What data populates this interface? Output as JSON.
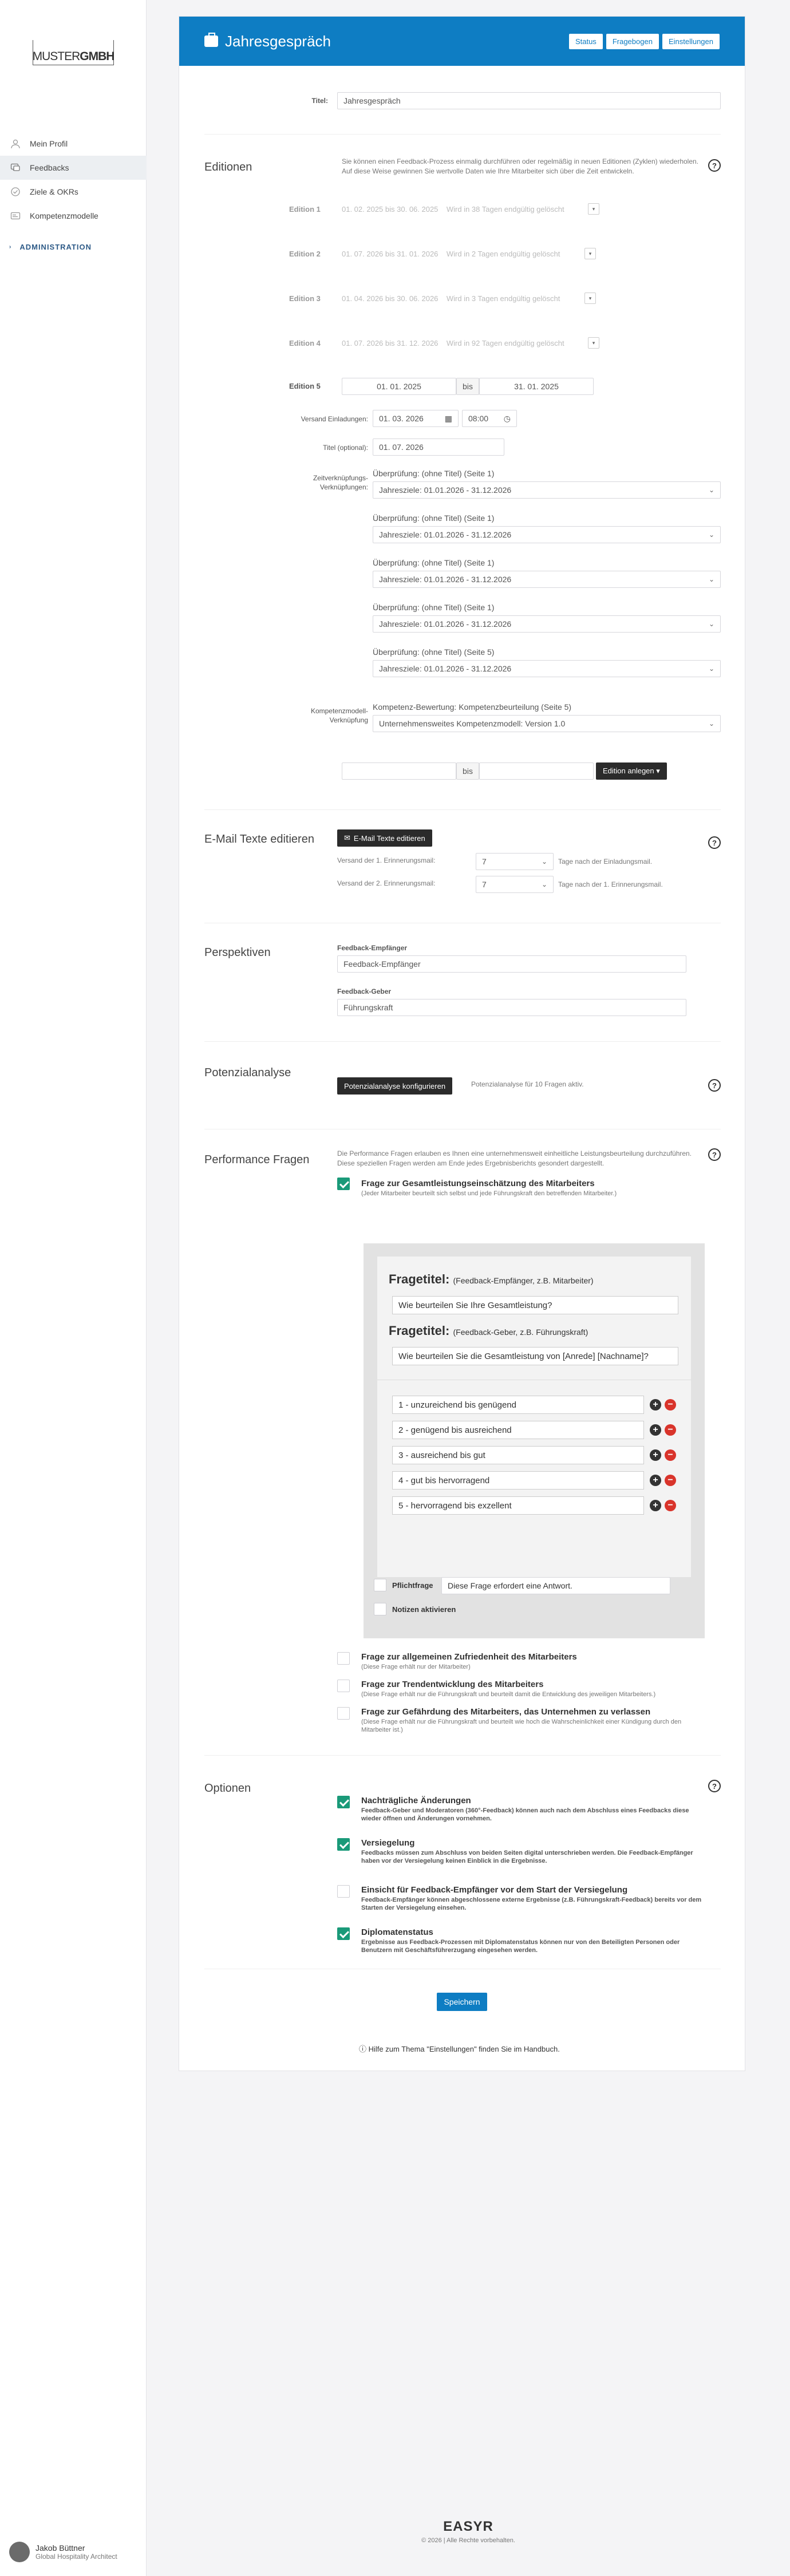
{
  "sidebar": {
    "logo_light": "MUSTER",
    "logo_bold": "GMBH",
    "items": [
      {
        "label": "Mein Profil",
        "icon": "user-icon"
      },
      {
        "label": "Feedbacks",
        "icon": "chat-icon"
      },
      {
        "label": "Ziele & OKRs",
        "icon": "target-icon"
      },
      {
        "label": "Kompetenzmodelle",
        "icon": "id-card-icon"
      }
    ],
    "admin_label": "ADMINISTRATION",
    "user_name": "Jakob Büttner",
    "user_role": "Global Hospitality Architect"
  },
  "header": {
    "title": "Jahresgespräch",
    "buttons": [
      "Status",
      "Fragebogen",
      "Einstellungen"
    ]
  },
  "titel": {
    "label": "Titel:",
    "value": "Jahresgespräch"
  },
  "editionen": {
    "title": "Editionen",
    "description": "Sie können einen Feedback-Prozess einmalig durchführen oder regelmäßig in neuen Editionen (Zyklen) wiederholen. Auf diese Weise gewinnen Sie wertvolle Daten wie Ihre Mitarbeiter sich über die Zeit entwickeln.",
    "list": [
      {
        "label": "Edition 1",
        "text": "01. 02. 2025 bis 30. 06. 2025    Wird in 38 Tagen endgültig gelöscht"
      },
      {
        "label": "Edition 2",
        "text": "01. 07. 2026 bis 31. 01. 2026    Wird in 2 Tagen endgültig gelöscht"
      },
      {
        "label": "Edition 3",
        "text": "01. 04. 2026 bis 30. 06. 2026    Wird in 3 Tagen endgültig gelöscht"
      },
      {
        "label": "Edition 4",
        "text": "01. 07. 2026 bis 31. 12. 2026    Wird in 92 Tagen endgültig gelöscht"
      }
    ],
    "current": {
      "label": "Edition 5",
      "from": "01. 01. 2025",
      "bis": "bis",
      "to": "31. 01. 2025",
      "versand_label": "Versand Einladungen:",
      "versand_date": "01. 03. 2026",
      "versand_time": "08:00",
      "titel_label": "Titel (optional):",
      "titel_value": "01. 07. 2026",
      "zeitverk_label": "Zeitverknüpfungs-Verknüpfungen:",
      "links": [
        {
          "label": "Überprüfung: (ohne Titel) (Seite 1)",
          "value": "Jahresziele: 01.01.2026 - 31.12.2026"
        },
        {
          "label": "Überprüfung: (ohne Titel) (Seite 1)",
          "value": "Jahresziele: 01.01.2026 - 31.12.2026"
        },
        {
          "label": "Überprüfung: (ohne Titel) (Seite 1)",
          "value": "Jahresziele: 01.01.2026 - 31.12.2026"
        },
        {
          "label": "Überprüfung: (ohne Titel) (Seite 1)",
          "value": "Jahresziele: 01.01.2026 - 31.12.2026"
        },
        {
          "label": "Überprüfung: (ohne Titel) (Seite 5)",
          "value": "Jahresziele: 01.01.2026 - 31.12.2026"
        }
      ],
      "kompetenz_label": "Kompetenzmodell-Verknüpfung",
      "kompetenz_title": "Kompetenz-Bewertung: Kompetenzbeurteilung (Seite 5)",
      "kompetenz_value": "Unternehmensweites Kompetenzmodell: Version 1.0"
    },
    "new_bis": "bis",
    "new_button": "Edition anlegen ▾"
  },
  "email": {
    "title": "E-Mail Texte editieren",
    "button": "E-Mail Texte editieren",
    "rows": [
      {
        "label": "Versand der 1. Erinnerungsmail:",
        "value": "7",
        "suffix": "Tage nach der Einladungsmail."
      },
      {
        "label": "Versand der 2. Erinnerungsmail:",
        "value": "7",
        "suffix": "Tage nach der 1. Erinnerungsmail."
      }
    ]
  },
  "perspektiven": {
    "title": "Perspektiven",
    "empf_label": "Feedback-Empfänger",
    "empf_value": "Feedback-Empfänger",
    "geber_label": "Feedback-Geber",
    "geber_value": "Führungskraft"
  },
  "potenzial": {
    "title": "Potenzialanalyse",
    "button": "Potenzialanalyse konfigurieren",
    "info": "Potenzialanalyse für 10 Fragen aktiv."
  },
  "performance": {
    "title": "Performance Fragen",
    "description": "Die Performance Fragen erlauben es Ihnen eine unternehmensweit einheitliche Leistungsbeurteilung durchzuführen. Diese speziellen Fragen werden am Ende jedes Ergebnisberichts gesondert dargestellt.",
    "q1_title": "Frage zur Gesamtleistungseinschätzung des Mitarbeiters",
    "q1_sub": "(Jeder Mitarbeiter beurteilt sich selbst und jede Führungskraft den betreffenden Mitarbeiter.)",
    "ft_label": "Fragetitel:",
    "ft1_sub": "(Feedback-Empfänger, z.B. Mitarbeiter)",
    "ft1_value": "Wie beurteilen Sie Ihre Gesamtleistung?",
    "ft2_sub": "(Feedback-Geber, z.B. Führungskraft)",
    "ft2_value": "Wie beurteilen Sie die Gesamtleistung von [Anrede] [Nachname]?",
    "answers": [
      "1 - unzureichend bis genügend",
      "2 - genügend bis ausreichend",
      "3 - ausreichend bis gut",
      "4 - gut bis hervorragend",
      "5 - hervorragend bis exzellent"
    ],
    "pflicht_label": "Pflichtfrage",
    "pflicht_value": "Diese Frage erfordert eine Antwort.",
    "notizen_label": "Notizen aktivieren",
    "others": [
      {
        "title": "Frage zur allgemeinen Zufriedenheit des Mitarbeiters",
        "sub": "(Diese Frage erhält nur der Mitarbeiter)"
      },
      {
        "title": "Frage zur Trendentwicklung des Mitarbeiters",
        "sub": "(Diese Frage erhält nur die Führungskraft und beurteilt damit die Entwicklung des jeweiligen Mitarbeiters.)"
      },
      {
        "title": "Frage zur Gefährdung des Mitarbeiters, das Unternehmen zu verlassen",
        "sub": "(Diese Frage erhält nur die Führungskraft und beurteilt wie hoch die Wahrscheinlichkeit einer Kündigung durch den Mitarbeiter ist.)"
      }
    ]
  },
  "optionen": {
    "title": "Optionen",
    "items": [
      {
        "title": "Nachträgliche Änderungen",
        "sub": "Feedback-Geber und Moderatoren (360°-Feedback) können auch nach dem Abschluss eines Feedbacks diese wieder öffnen und Änderungen vornehmen."
      },
      {
        "title": "Versiegelung",
        "sub": "Feedbacks müssen zum Abschluss von beiden Seiten digital unterschrieben werden. Die Feedback-Empfänger haben vor der Versiegelung keinen Einblick in die Ergebnisse."
      },
      {
        "title": "Einsicht für Feedback-Empfänger vor dem Start der Versiegelung",
        "sub": "Feedback-Empfänger können abgeschlossene externe Ergebnisse (z.B. Führungskraft-Feedback) bereits vor dem Starten der Versiegelung einsehen."
      },
      {
        "title": "Diplomatenstatus",
        "sub": "Ergebnisse aus Feedback-Prozessen mit Diplomatenstatus können nur von den Beteiligten Personen oder Benutzern mit Geschäftsführerzugang eingesehen werden."
      }
    ],
    "checked": [
      true,
      true,
      false,
      true
    ]
  },
  "save_label": "Speichern",
  "help_text": "Hilfe zum Thema \"Einstellungen\" finden Sie im Handbuch.",
  "footer": {
    "logo": "EASYR",
    "copy": "© 2026 | Alle Rechte vorbehalten."
  }
}
